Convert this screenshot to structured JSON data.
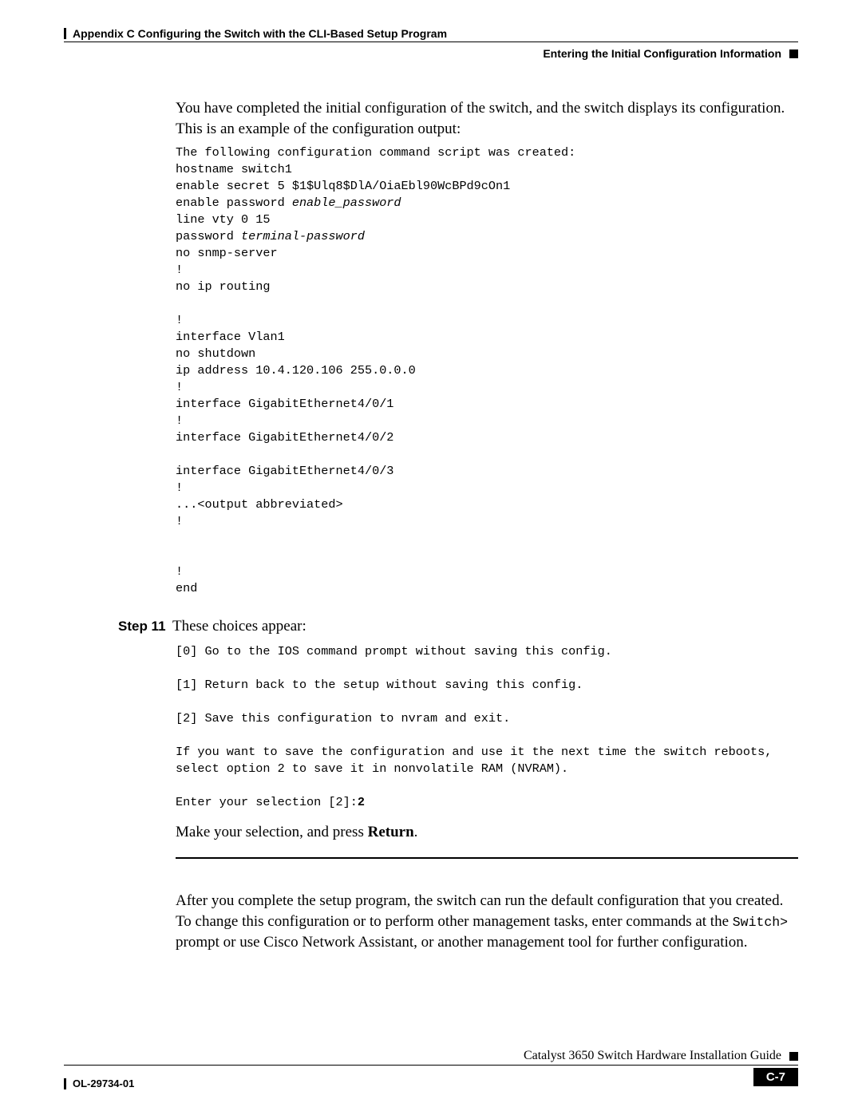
{
  "header": {
    "chapter": "Appendix C      Configuring the Switch with the CLI-Based Setup Program",
    "section": "Entering the Initial Configuration Information"
  },
  "intro": "You have completed the initial configuration of the switch, and the switch displays its configuration. This is an example of the configuration output:",
  "config_pre_1": "The following configuration command script was created:\nhostname switch1\nenable secret 5 $1$Ulq8$DlA/OiaEbl90WcBPd9cOn1\nenable password ",
  "config_italic_1": "enable_password",
  "config_pre_2": "\nline vty 0 15\npassword ",
  "config_italic_2": "terminal-password",
  "config_pre_3": "\nno snmp-server\n!\nno ip routing\n\n!\ninterface Vlan1\nno shutdown\nip address 10.4.120.106 255.0.0.0\n!\ninterface GigabitEthernet4/0/1\n!\ninterface GigabitEthernet4/0/2\n\ninterface GigabitEthernet4/0/3\n!\n...<output abbreviated>\n!\n\n\n!\nend",
  "step11_label": "Step 11",
  "step11_text": "These choices appear:",
  "step11_pre": "[0] Go to the IOS command prompt without saving this config.\n\n[1] Return back to the setup without saving this config.\n\n[2] Save this configuration to nvram and exit.\n\nIf you want to save the configuration and use it the next time the switch reboots, select option 2 to save it in nonvolatile RAM (NVRAM).\n\nEnter your selection [2]:",
  "step11_bold": "2",
  "step11_body_1": "Make your selection, and press ",
  "step11_body_bold": "Return",
  "step11_body_2": ".",
  "after_para_1": "After you complete the setup program, the switch can run the default configuration that you created. To change this configuration or to perform other management tasks, enter commands at the ",
  "after_switch_mono": "Switch>",
  "after_para_2": " prompt or use Cisco Network Assistant, or another management tool for further configuration.",
  "footer": {
    "guide": "Catalyst 3650 Switch Hardware Installation Guide",
    "docnum": "OL-29734-01",
    "pagenum": "C-7"
  }
}
